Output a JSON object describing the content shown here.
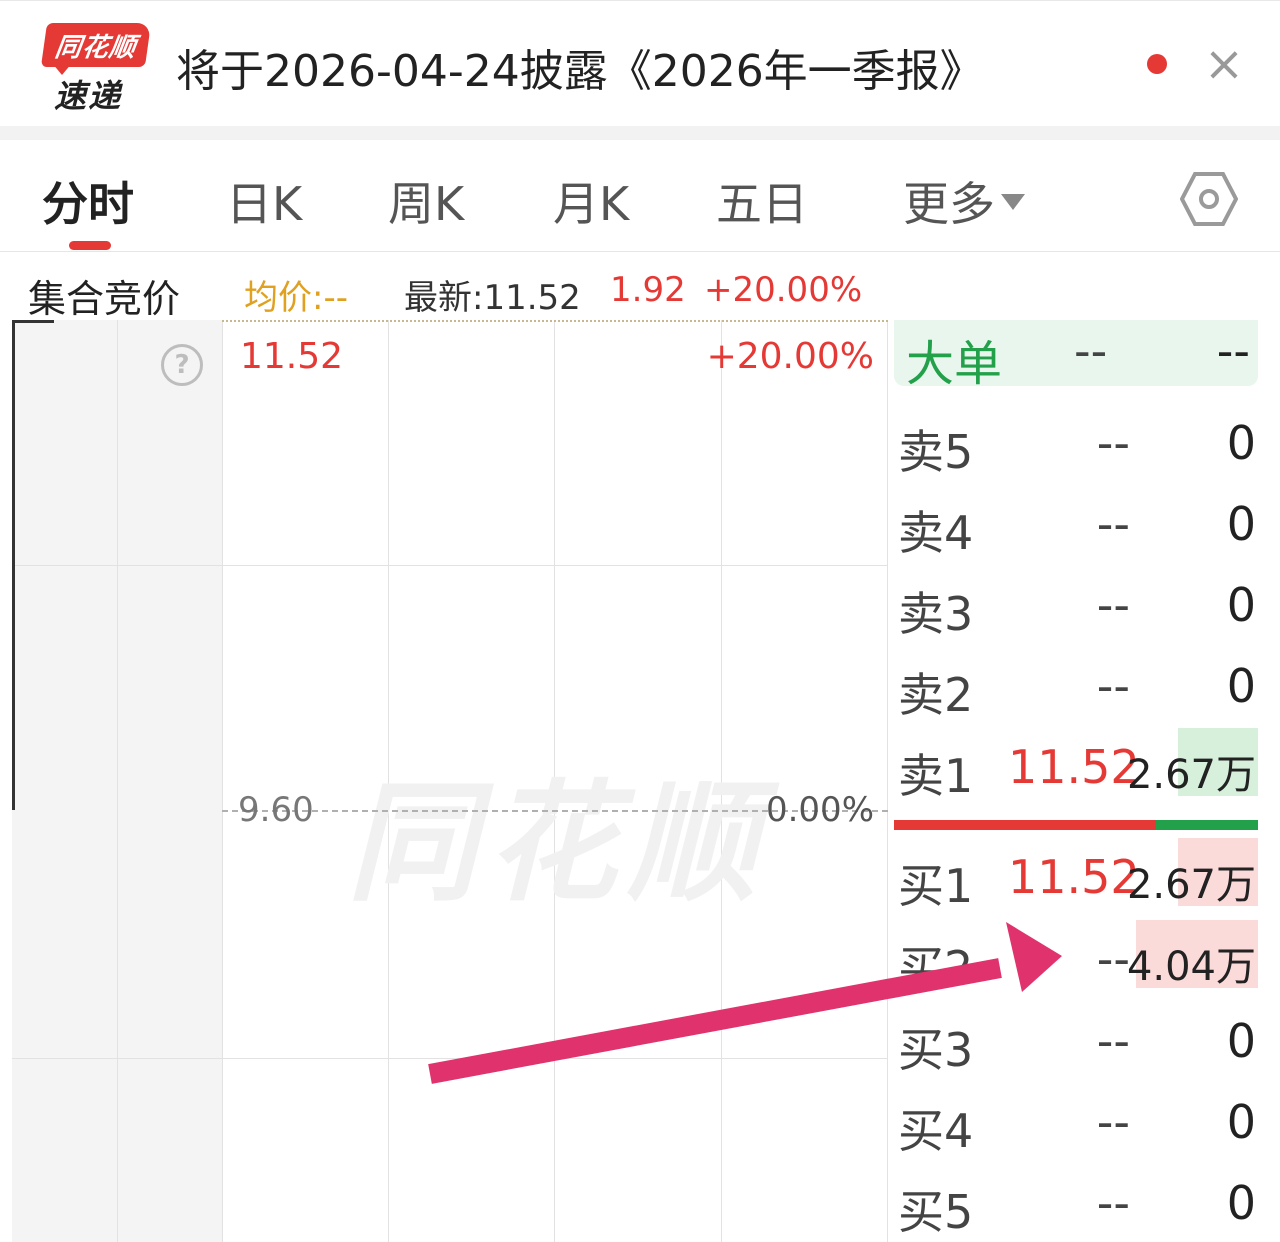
{
  "notice": {
    "logo_top": "同花顺",
    "logo_bottom": "速递",
    "text": "将于2026-04-24披露《2026年一季报》",
    "close_symbol": "×"
  },
  "tabs": [
    {
      "label": "分时",
      "active": true
    },
    {
      "label": "日K"
    },
    {
      "label": "周K"
    },
    {
      "label": "月K"
    },
    {
      "label": "五日"
    },
    {
      "label": "更多"
    }
  ],
  "info": {
    "auction_label": "集合竞价",
    "avg": "均价:--",
    "latest": "最新:11.52",
    "change": "1.92",
    "change_pct": "+20.00%"
  },
  "chart": {
    "top_price": "11.52",
    "top_pct": "+20.00%",
    "mid_price": "9.60",
    "mid_pct": "0.00%",
    "help_symbol": "?",
    "watermark": "同花顺"
  },
  "book": {
    "big_order": {
      "label": "大单",
      "mid": "--",
      "right": "--"
    },
    "sells": [
      {
        "label": "卖5",
        "price": "--",
        "vol": "0"
      },
      {
        "label": "卖4",
        "price": "--",
        "vol": "0"
      },
      {
        "label": "卖3",
        "price": "--",
        "vol": "0"
      },
      {
        "label": "卖2",
        "price": "--",
        "vol": "0"
      },
      {
        "label": "卖1",
        "price": "11.52",
        "vol": "2.67万"
      }
    ],
    "buys": [
      {
        "label": "买1",
        "price": "11.52",
        "vol": "2.67万"
      },
      {
        "label": "买2",
        "price": "--",
        "vol": "4.04万"
      },
      {
        "label": "买3",
        "price": "--",
        "vol": "0"
      },
      {
        "label": "买4",
        "price": "--",
        "vol": "0"
      },
      {
        "label": "买5",
        "price": "--",
        "vol": "0"
      }
    ]
  },
  "colors": {
    "up": "#e53935",
    "down": "#22a04a",
    "avg": "#e0a020",
    "annotation_arrow": "#e0336e"
  }
}
